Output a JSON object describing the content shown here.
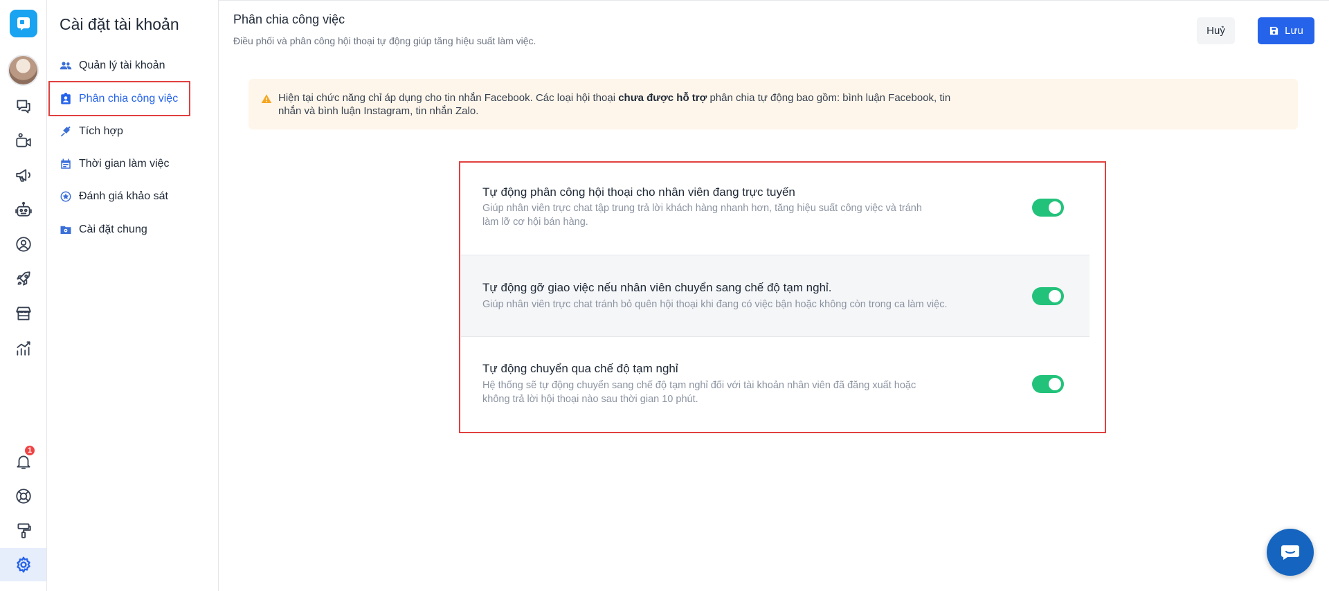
{
  "sidenav": {
    "title": "Cài đặt tài khoản",
    "items": [
      {
        "label": "Quản lý tài khoản",
        "icon": "users-icon"
      },
      {
        "label": "Phân chia công việc",
        "icon": "assignment-icon",
        "active": true
      },
      {
        "label": "Tích hợp",
        "icon": "plug-icon"
      },
      {
        "label": "Thời gian làm việc",
        "icon": "calendar-icon"
      },
      {
        "label": "Đánh giá khảo sát",
        "icon": "survey-icon"
      },
      {
        "label": "Cài đặt chung",
        "icon": "folder-settings-icon"
      }
    ]
  },
  "rail": {
    "notification_count": "1",
    "icons": [
      "app-logo-icon",
      "avatar",
      "chat-icon",
      "video-icon",
      "megaphone-icon",
      "bot-icon",
      "contact-icon",
      "rocket-icon",
      "store-icon",
      "analytics-icon",
      "bell-icon",
      "help-icon",
      "paint-roller-icon",
      "gear-icon"
    ]
  },
  "header": {
    "title": "Phân chia công việc",
    "subtitle": "Điều phối và phân công hội thoại tự động giúp tăng hiệu suất làm việc.",
    "cancel_label": "Huỷ",
    "save_label": "Lưu"
  },
  "alert": {
    "text_before": "Hiện tại chức năng chỉ áp dụng cho tin nhắn Facebook. Các loại hội thoại ",
    "text_bold": "chưa được hỗ trợ",
    "text_after": " phân chia tự động bao gồm: bình luận Facebook, tin nhắn và bình luận Instagram, tin nhắn Zalo."
  },
  "settings": [
    {
      "title": "Tự động phân công hội thoại cho nhân viên đang trực tuyến",
      "description": "Giúp nhân viên trực chat tập trung trả lời khách hàng nhanh hơn, tăng hiệu suất công việc và tránh làm lỡ cơ hội bán hàng.",
      "enabled": true
    },
    {
      "title": "Tự động gỡ giao việc nếu nhân viên chuyển sang chế độ tạm nghỉ.",
      "description": "Giúp nhân viên trực chat tránh bỏ quên hội thoại khi đang có việc bận hoặc không còn trong ca làm việc.",
      "enabled": true
    },
    {
      "title": "Tự động chuyển qua chế độ tạm nghỉ",
      "description": "Hệ thống sẽ tự động chuyển sang chế độ tạm nghỉ đối với tài khoản nhân viên đã đăng xuất hoặc không trả lời hội thoại nào sau thời gian 10 phút.",
      "enabled": true
    }
  ],
  "colors": {
    "primary": "#2563eb",
    "toggle_on": "#22c27a",
    "alert_bg": "#fef6ea",
    "highlight": "#e0403f"
  }
}
